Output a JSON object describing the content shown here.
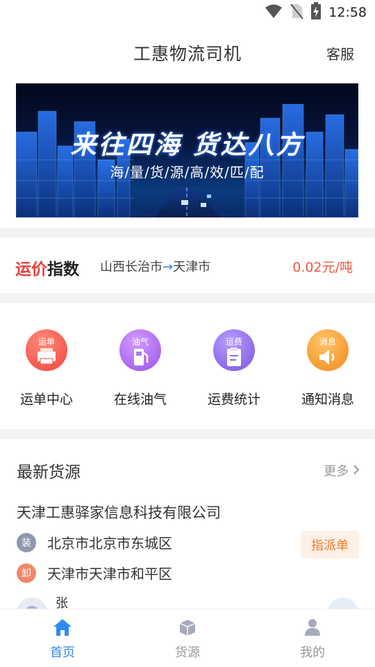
{
  "status_bar": {
    "time": "12:58",
    "icons": [
      "wifi-icon",
      "no-sim-icon",
      "battery-charging-icon"
    ]
  },
  "header": {
    "title": "工惠物流司机",
    "service_label": "客服"
  },
  "banner": {
    "slogan": "来往四海 货达八方",
    "subtitle": "海/量/货/源/高/效/匹/配"
  },
  "freight_index": {
    "logo_red": "运价",
    "logo_dark": "指数",
    "origin": "山西长治市",
    "arrow": "→",
    "destination": "天津市",
    "price": "0.02元/吨"
  },
  "menu": [
    {
      "tag": "运单",
      "label": "运单中心",
      "icon": "waybill-icon",
      "color": "#f0544c"
    },
    {
      "tag": "油气",
      "label": "在线油气",
      "icon": "fuel-pump-icon",
      "color": "#a764e8"
    },
    {
      "tag": "运费",
      "label": "运费统计",
      "icon": "freight-stats-icon",
      "color": "#8b63e6"
    },
    {
      "tag": "消息",
      "label": "通知消息",
      "icon": "speaker-icon",
      "color": "#f59a2a"
    }
  ],
  "cargo": {
    "section_title": "最新货源",
    "more_label": "更多",
    "company": "天津工惠驿家信息科技有限公司",
    "load_tag": "装",
    "load_address": "北京市北京市东城区",
    "unload_tag": "卸",
    "unload_address": "天津市天津市和平区",
    "assign_label": "指派单",
    "contact_name": "张"
  },
  "tabs": [
    {
      "label": "首页",
      "icon": "home-icon",
      "active": true
    },
    {
      "label": "货源",
      "icon": "cargo-box-icon",
      "active": false
    },
    {
      "label": "我的",
      "icon": "user-icon",
      "active": false
    }
  ],
  "colors": {
    "accent": "#2e8cf0",
    "price": "#f2553a",
    "assign": "#f07b2e"
  }
}
